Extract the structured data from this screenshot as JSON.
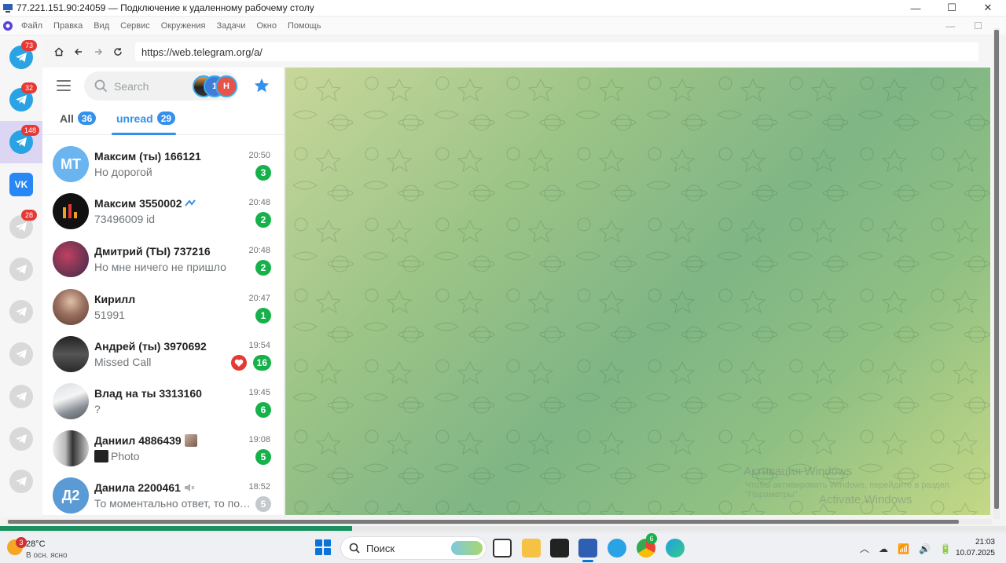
{
  "window": {
    "title": "77.221.151.90:24059 — Подключение к удаленному рабочему столу",
    "minimize": "—",
    "maximize": "☐",
    "close": "✕"
  },
  "menu": {
    "items": [
      "Файл",
      "Правка",
      "Вид",
      "Сервис",
      "Окружения",
      "Задачи",
      "Окно",
      "Помощь"
    ],
    "minimize": "—",
    "maximize": "☐"
  },
  "rail": {
    "accounts": [
      {
        "type": "telegram",
        "badge": "73"
      },
      {
        "type": "telegram",
        "badge": "32"
      },
      {
        "type": "telegram",
        "badge": "148",
        "active": true
      },
      {
        "type": "vk",
        "label": "VK"
      },
      {
        "type": "telegram-dim",
        "badge": "28"
      },
      {
        "type": "telegram-dim"
      },
      {
        "type": "telegram-dim"
      },
      {
        "type": "telegram-dim"
      },
      {
        "type": "telegram-dim"
      },
      {
        "type": "telegram-dim"
      },
      {
        "type": "telegram-dim"
      }
    ]
  },
  "browser": {
    "url": "https://web.telegram.org/a/"
  },
  "sidebar": {
    "search_placeholder": "Search",
    "stories": [
      "",
      "1",
      "Н"
    ],
    "tabs": [
      {
        "label": "All",
        "count": "36"
      },
      {
        "label": "unread",
        "count": "29"
      }
    ],
    "chats": [
      {
        "name": "Максим (ты) 166121",
        "time": "20:50",
        "message": "Но дорогой",
        "unread": "3",
        "avatar_initials": "МТ",
        "avatar_color": "#6ab4f0"
      },
      {
        "name": "Максим 3550002",
        "time": "20:48",
        "message": "73496009 id",
        "unread": "2",
        "avatar_initials": "",
        "avatar_color": "#111111"
      },
      {
        "name": "Дмитрий (ТЫ) 737216",
        "time": "20:48",
        "message": "Но мне ничего не пришло",
        "unread": "2",
        "avatar_initials": "",
        "avatar_color": "#5a4a6e"
      },
      {
        "name": "Кирилл",
        "time": "20:47",
        "message": "51991",
        "unread": "1",
        "avatar_initials": "",
        "avatar_color": "#a08070"
      },
      {
        "name": "Андрей (ты) 3970692",
        "time": "19:54",
        "message": "Missed Call",
        "unread": "16",
        "avatar_initials": "",
        "avatar_color": "#3a3a3a"
      },
      {
        "name": "Влад на ты 3313160",
        "time": "19:45",
        "message": "?",
        "unread": "6",
        "avatar_initials": "",
        "avatar_color": "#8a9098"
      },
      {
        "name": "Даниил 4886439",
        "time": "19:08",
        "message": "Photo",
        "unread": "5",
        "avatar_initials": "",
        "avatar_color": "#6a6a6a"
      },
      {
        "name": "Данила 2200461",
        "time": "18:52",
        "message": "То моментально ответ, то пол...",
        "unread": "5",
        "avatar_initials": "Д2",
        "avatar_color": "#5b9bd5",
        "muted": true
      }
    ]
  },
  "watermark": {
    "line1": "Активация Windows",
    "line2": "Чтобы активировать Windows, перейдите в раздел",
    "line3": "\"Параметры\"",
    "line4": "Activate Windows"
  },
  "scroll_progress_fraction": 0.35,
  "taskbar": {
    "weather_temp": "28°C",
    "weather_desc": "В осн. ясно",
    "weather_badge": "3",
    "search_label": "Поиск",
    "time": "21:03",
    "date": "10.07.2025",
    "edge_badge": "6"
  },
  "colors": {
    "accent": "#3390ec",
    "unread_badge": "#17b14c",
    "telegram": "#2aa3e5"
  }
}
